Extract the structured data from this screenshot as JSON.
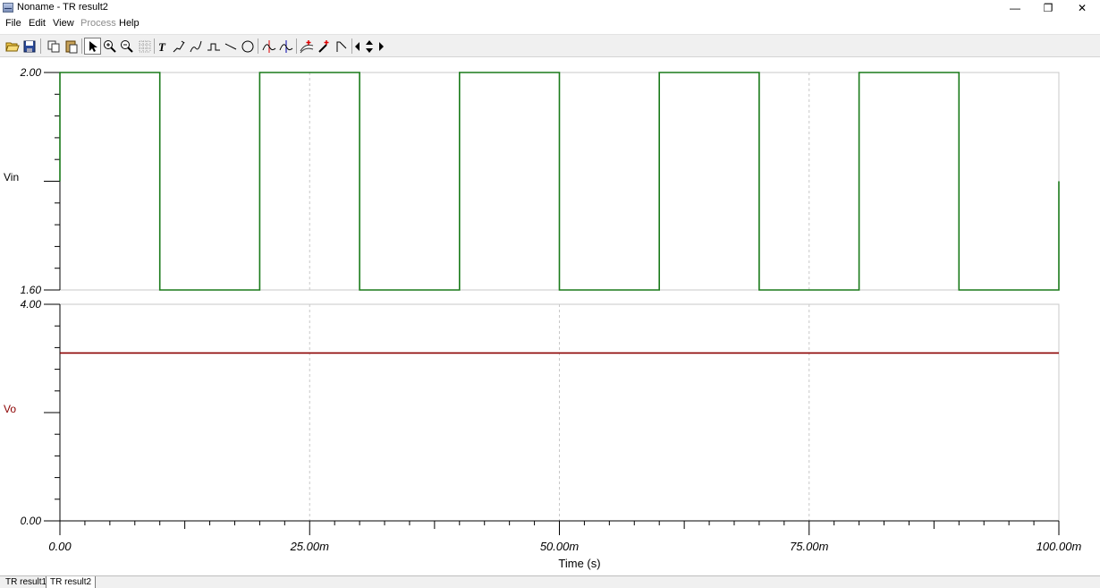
{
  "window": {
    "title": "Noname - TR result2",
    "minimize": "—",
    "restore": "❐",
    "close": "✕"
  },
  "menu": [
    "File",
    "Edit",
    "View",
    "Process",
    "Help"
  ],
  "toolbar_icons": [
    "open-folder-icon",
    "save-icon",
    "copy-icon",
    "paste-icon",
    "pointer-icon",
    "zoom-in-icon",
    "zoom-out-icon",
    "grid-icon",
    "text-icon",
    "pen-icon",
    "pen-curve-icon",
    "step-icon",
    "step-fill-icon",
    "line-icon",
    "circle-icon",
    "cursor-a-icon",
    "cursor-b-icon",
    "curve-add-icon",
    "marker-icon",
    "corner-icon",
    "arrow-left-icon",
    "arrow-updown-icon",
    "arrow-right-icon"
  ],
  "tabs": [
    "TR result1",
    "TR result2"
  ],
  "active_tab": 1,
  "chart_data": [
    {
      "type": "line",
      "ylabel": "Vin",
      "ylim": [
        1.6,
        2.0
      ],
      "ytick_labels": [
        "2.00",
        "1.60"
      ],
      "color": "#1a7a1a",
      "series": [
        {
          "name": "Vin",
          "x": [
            0,
            0,
            0.01,
            0.01,
            0.02,
            0.02,
            0.03,
            0.03,
            0.04,
            0.04,
            0.05,
            0.05,
            0.06,
            0.06,
            0.07,
            0.07,
            0.08,
            0.08,
            0.09,
            0.09,
            0.1,
            0.1
          ],
          "y": [
            1.8,
            2.0,
            2.0,
            1.6,
            1.6,
            2.0,
            2.0,
            1.6,
            1.6,
            2.0,
            2.0,
            1.6,
            1.6,
            2.0,
            2.0,
            1.6,
            1.6,
            2.0,
            2.0,
            1.6,
            1.6,
            1.8
          ]
        }
      ]
    },
    {
      "type": "line",
      "ylabel": "Vo",
      "ylim": [
        0,
        4.0
      ],
      "ytick_labels": [
        "4.00",
        "0.00"
      ],
      "color": "#8b0000",
      "series": [
        {
          "name": "Vo",
          "x": [
            0,
            0.1
          ],
          "y": [
            3.1,
            3.1
          ]
        }
      ]
    }
  ],
  "xaxis": {
    "label": "Time (s)",
    "xlim": [
      0,
      0.1
    ],
    "ticks": [
      0,
      0.025,
      0.05,
      0.075,
      0.1
    ],
    "tick_labels": [
      "0.00",
      "25.00m",
      "50.00m",
      "75.00m",
      "100.00m"
    ]
  }
}
